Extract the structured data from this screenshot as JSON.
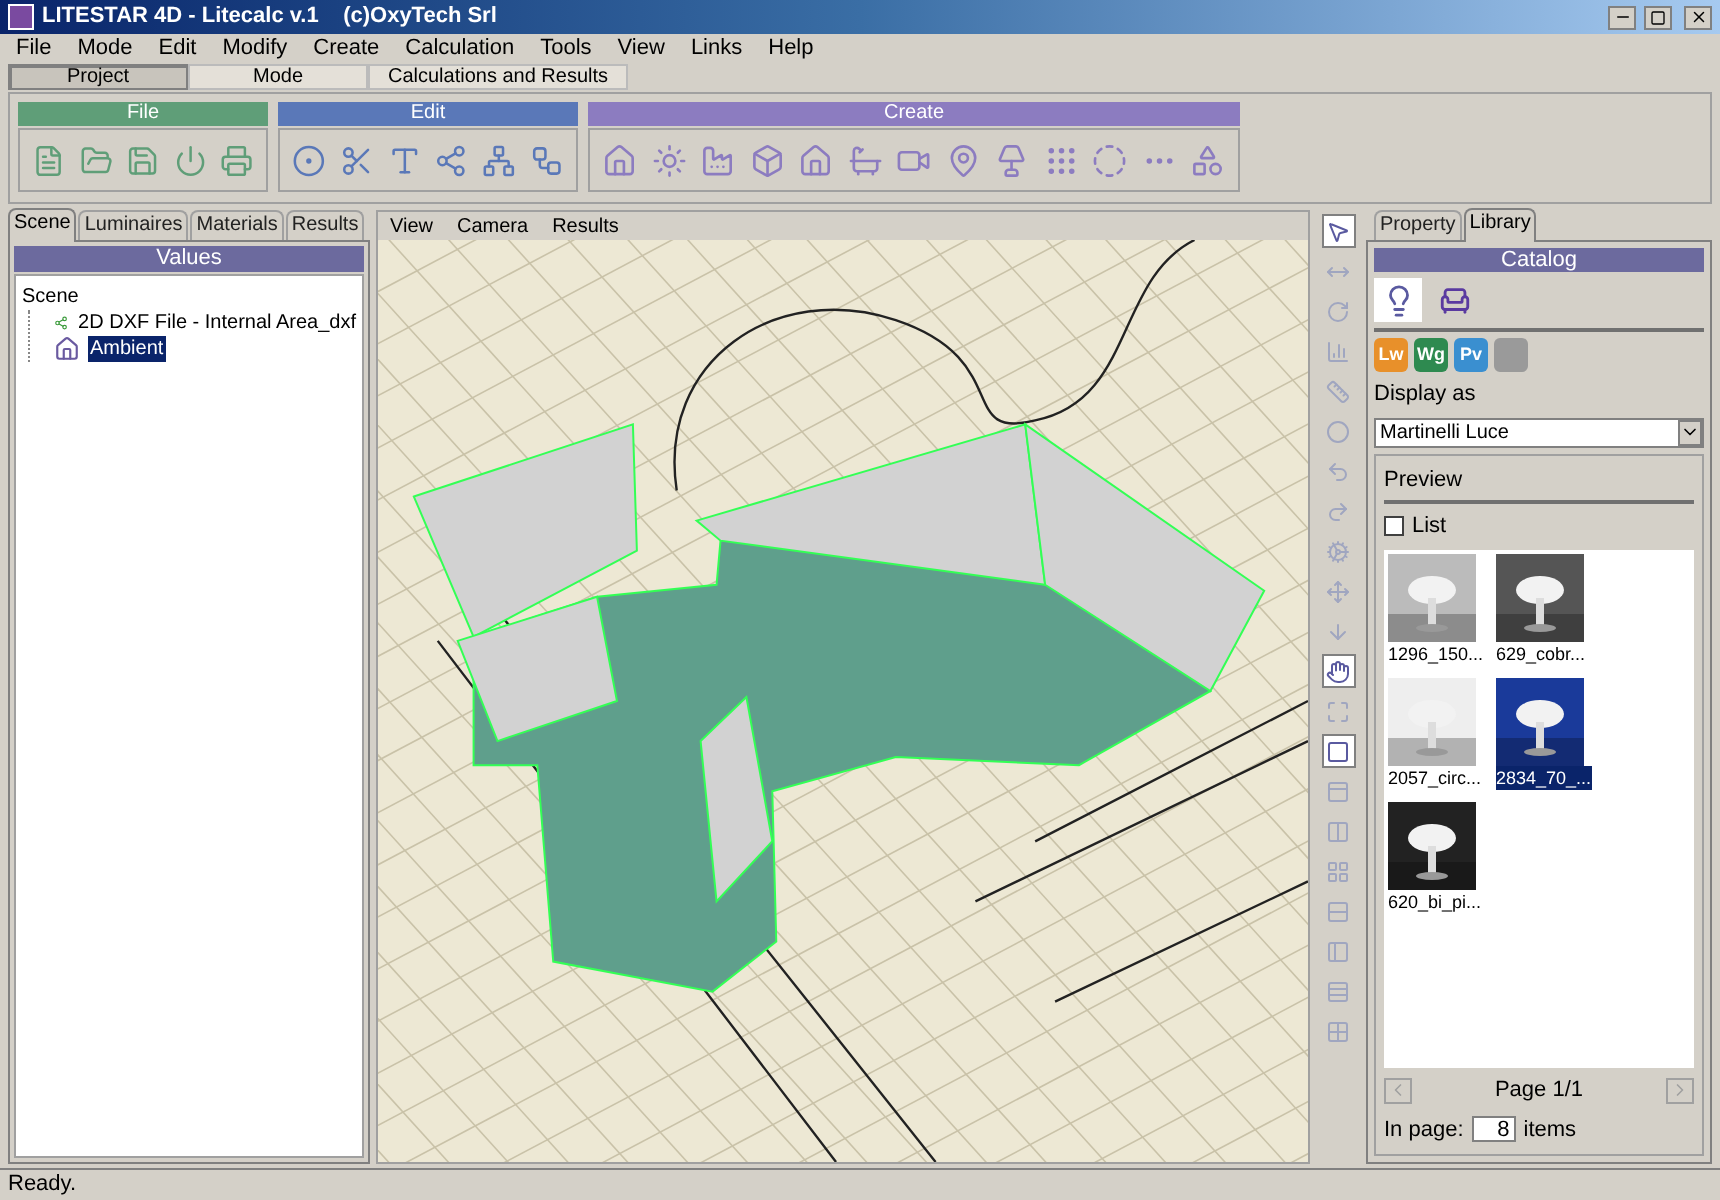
{
  "window": {
    "title": "LITESTAR 4D - Litecalc v.1    (c)OxyTech Srl"
  },
  "menu": [
    "File",
    "Mode",
    "Edit",
    "Modify",
    "Create",
    "Calculation",
    "Tools",
    "View",
    "Links",
    "Help"
  ],
  "mode_tabs": [
    {
      "label": "Project",
      "selected": true
    },
    {
      "label": "Mode",
      "selected": false
    },
    {
      "label": "Calculations and Results",
      "selected": false
    }
  ],
  "toolbar_groups": [
    {
      "title": "File",
      "color": "#5f9e78"
    },
    {
      "title": "Edit",
      "color": "#5a78b8"
    },
    {
      "title": "Create",
      "color": "#8c7cc0"
    }
  ],
  "left_panel": {
    "tabs": [
      {
        "label": "Scene",
        "selected": true
      },
      {
        "label": "Luminaires",
        "selected": false
      },
      {
        "label": "Materials",
        "selected": false
      },
      {
        "label": "Results",
        "selected": false
      }
    ],
    "header": "Values",
    "tree": [
      {
        "label": "Scene",
        "selected": false,
        "children": [
          {
            "label": "2D DXF File - Internal Area_dxf",
            "kind": "dxf",
            "selected": false
          },
          {
            "label": "Ambient",
            "kind": "ambient",
            "selected": true
          }
        ]
      }
    ]
  },
  "viewport": {
    "menu": [
      "View",
      "Camera",
      "Results"
    ]
  },
  "side_tools": [
    {
      "selected": true
    },
    {
      "selected": false
    },
    {
      "selected": false
    },
    {
      "selected": false
    },
    {
      "selected": false
    },
    {
      "selected": false
    },
    {
      "selected": false
    },
    {
      "selected": false
    },
    {
      "selected": false
    },
    {
      "selected": false
    },
    {
      "selected": false
    },
    {
      "selected": true
    },
    {
      "selected": false
    },
    {
      "selected": true
    },
    {
      "selected": false
    },
    {
      "selected": false
    },
    {
      "selected": false
    },
    {
      "selected": false
    },
    {
      "selected": false
    },
    {
      "selected": false
    },
    {
      "selected": false
    }
  ],
  "right_panel": {
    "tabs": [
      {
        "label": "Property",
        "selected": false
      },
      {
        "label": "Library",
        "selected": true
      }
    ],
    "header": "Catalog",
    "categories": [
      {
        "kind": "lamp",
        "selected": true
      },
      {
        "kind": "furniture",
        "selected": false
      }
    ],
    "sources": [
      {
        "label": "Lw",
        "color": "#e8902a"
      },
      {
        "label": "Wg",
        "color": "#2e8a50"
      },
      {
        "label": "Pv",
        "color": "#3a8fd0"
      }
    ],
    "display_as_label": "Display as",
    "display_as_value": "Martinelli Luce",
    "preview_title": "Preview",
    "list_checkbox": {
      "label": "List",
      "checked": false
    },
    "items": [
      {
        "caption": "1296_150...",
        "selected": false
      },
      {
        "caption": "629_cobr...",
        "selected": false
      },
      {
        "caption": "2057_circ...",
        "selected": false
      },
      {
        "caption": "2834_70_...",
        "selected": true
      },
      {
        "caption": "620_bi_pi...",
        "selected": false
      }
    ],
    "page": "Page 1/1",
    "in_page_label": "In page:",
    "in_page_value": "8",
    "items_label": "items"
  },
  "status_bar": "Ready."
}
